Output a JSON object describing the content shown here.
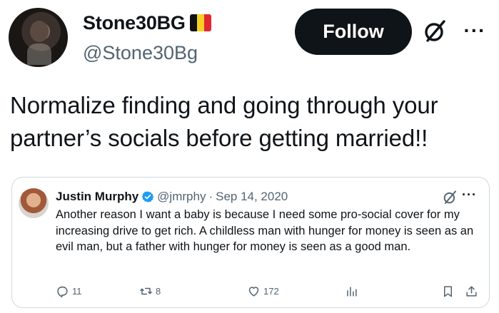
{
  "post": {
    "author": {
      "display_name": "Stone30BG",
      "handle": "@Stone30Bg",
      "flag_colors": [
        "#111111",
        "#f5d026",
        "#e02830"
      ]
    },
    "follow_label": "Follow",
    "text": "Normalize finding and going through your partner’s socials before getting married!!"
  },
  "quote": {
    "author": {
      "display_name": "Justin Murphy",
      "handle": "@jmrphy",
      "date": "Sep 14, 2020",
      "separator": "·"
    },
    "more_label": "···",
    "text": "Another reason I want a baby is because I need some pro-social cover for my increasing drive to get rich. A childless man with hunger for money is seen as an evil man, but a father with hunger for money is seen as a good man.",
    "metrics": {
      "replies": "11",
      "reposts": "8",
      "likes": "172"
    }
  },
  "icons": {
    "grok": "grok-icon",
    "more": "more-icon",
    "verified": "verified-badge-icon",
    "reply": "reply-icon",
    "repost": "repost-icon",
    "like": "heart-icon",
    "views": "views-icon",
    "bookmark": "bookmark-icon",
    "share": "share-icon"
  },
  "colors": {
    "text_primary": "#0f1419",
    "text_secondary": "#536471",
    "verified_blue": "#1d9bf0",
    "card_border": "#cfd9de"
  }
}
